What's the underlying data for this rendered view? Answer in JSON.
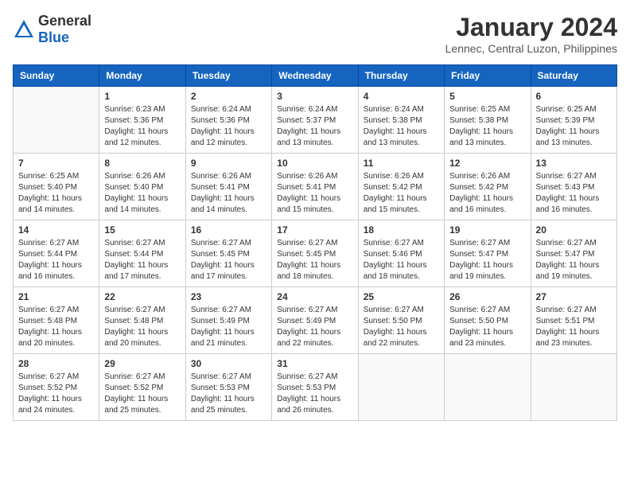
{
  "header": {
    "logo_general": "General",
    "logo_blue": "Blue",
    "title": "January 2024",
    "subtitle": "Lennec, Central Luzon, Philippines"
  },
  "weekdays": [
    "Sunday",
    "Monday",
    "Tuesday",
    "Wednesday",
    "Thursday",
    "Friday",
    "Saturday"
  ],
  "weeks": [
    [
      {
        "day": "",
        "info": ""
      },
      {
        "day": "1",
        "info": "Sunrise: 6:23 AM\nSunset: 5:36 PM\nDaylight: 11 hours\nand 12 minutes."
      },
      {
        "day": "2",
        "info": "Sunrise: 6:24 AM\nSunset: 5:36 PM\nDaylight: 11 hours\nand 12 minutes."
      },
      {
        "day": "3",
        "info": "Sunrise: 6:24 AM\nSunset: 5:37 PM\nDaylight: 11 hours\nand 13 minutes."
      },
      {
        "day": "4",
        "info": "Sunrise: 6:24 AM\nSunset: 5:38 PM\nDaylight: 11 hours\nand 13 minutes."
      },
      {
        "day": "5",
        "info": "Sunrise: 6:25 AM\nSunset: 5:38 PM\nDaylight: 11 hours\nand 13 minutes."
      },
      {
        "day": "6",
        "info": "Sunrise: 6:25 AM\nSunset: 5:39 PM\nDaylight: 11 hours\nand 13 minutes."
      }
    ],
    [
      {
        "day": "7",
        "info": "Sunrise: 6:25 AM\nSunset: 5:40 PM\nDaylight: 11 hours\nand 14 minutes."
      },
      {
        "day": "8",
        "info": "Sunrise: 6:26 AM\nSunset: 5:40 PM\nDaylight: 11 hours\nand 14 minutes."
      },
      {
        "day": "9",
        "info": "Sunrise: 6:26 AM\nSunset: 5:41 PM\nDaylight: 11 hours\nand 14 minutes."
      },
      {
        "day": "10",
        "info": "Sunrise: 6:26 AM\nSunset: 5:41 PM\nDaylight: 11 hours\nand 15 minutes."
      },
      {
        "day": "11",
        "info": "Sunrise: 6:26 AM\nSunset: 5:42 PM\nDaylight: 11 hours\nand 15 minutes."
      },
      {
        "day": "12",
        "info": "Sunrise: 6:26 AM\nSunset: 5:42 PM\nDaylight: 11 hours\nand 16 minutes."
      },
      {
        "day": "13",
        "info": "Sunrise: 6:27 AM\nSunset: 5:43 PM\nDaylight: 11 hours\nand 16 minutes."
      }
    ],
    [
      {
        "day": "14",
        "info": "Sunrise: 6:27 AM\nSunset: 5:44 PM\nDaylight: 11 hours\nand 16 minutes."
      },
      {
        "day": "15",
        "info": "Sunrise: 6:27 AM\nSunset: 5:44 PM\nDaylight: 11 hours\nand 17 minutes."
      },
      {
        "day": "16",
        "info": "Sunrise: 6:27 AM\nSunset: 5:45 PM\nDaylight: 11 hours\nand 17 minutes."
      },
      {
        "day": "17",
        "info": "Sunrise: 6:27 AM\nSunset: 5:45 PM\nDaylight: 11 hours\nand 18 minutes."
      },
      {
        "day": "18",
        "info": "Sunrise: 6:27 AM\nSunset: 5:46 PM\nDaylight: 11 hours\nand 18 minutes."
      },
      {
        "day": "19",
        "info": "Sunrise: 6:27 AM\nSunset: 5:47 PM\nDaylight: 11 hours\nand 19 minutes."
      },
      {
        "day": "20",
        "info": "Sunrise: 6:27 AM\nSunset: 5:47 PM\nDaylight: 11 hours\nand 19 minutes."
      }
    ],
    [
      {
        "day": "21",
        "info": "Sunrise: 6:27 AM\nSunset: 5:48 PM\nDaylight: 11 hours\nand 20 minutes."
      },
      {
        "day": "22",
        "info": "Sunrise: 6:27 AM\nSunset: 5:48 PM\nDaylight: 11 hours\nand 20 minutes."
      },
      {
        "day": "23",
        "info": "Sunrise: 6:27 AM\nSunset: 5:49 PM\nDaylight: 11 hours\nand 21 minutes."
      },
      {
        "day": "24",
        "info": "Sunrise: 6:27 AM\nSunset: 5:49 PM\nDaylight: 11 hours\nand 22 minutes."
      },
      {
        "day": "25",
        "info": "Sunrise: 6:27 AM\nSunset: 5:50 PM\nDaylight: 11 hours\nand 22 minutes."
      },
      {
        "day": "26",
        "info": "Sunrise: 6:27 AM\nSunset: 5:50 PM\nDaylight: 11 hours\nand 23 minutes."
      },
      {
        "day": "27",
        "info": "Sunrise: 6:27 AM\nSunset: 5:51 PM\nDaylight: 11 hours\nand 23 minutes."
      }
    ],
    [
      {
        "day": "28",
        "info": "Sunrise: 6:27 AM\nSunset: 5:52 PM\nDaylight: 11 hours\nand 24 minutes."
      },
      {
        "day": "29",
        "info": "Sunrise: 6:27 AM\nSunset: 5:52 PM\nDaylight: 11 hours\nand 25 minutes."
      },
      {
        "day": "30",
        "info": "Sunrise: 6:27 AM\nSunset: 5:53 PM\nDaylight: 11 hours\nand 25 minutes."
      },
      {
        "day": "31",
        "info": "Sunrise: 6:27 AM\nSunset: 5:53 PM\nDaylight: 11 hours\nand 26 minutes."
      },
      {
        "day": "",
        "info": ""
      },
      {
        "day": "",
        "info": ""
      },
      {
        "day": "",
        "info": ""
      }
    ]
  ]
}
